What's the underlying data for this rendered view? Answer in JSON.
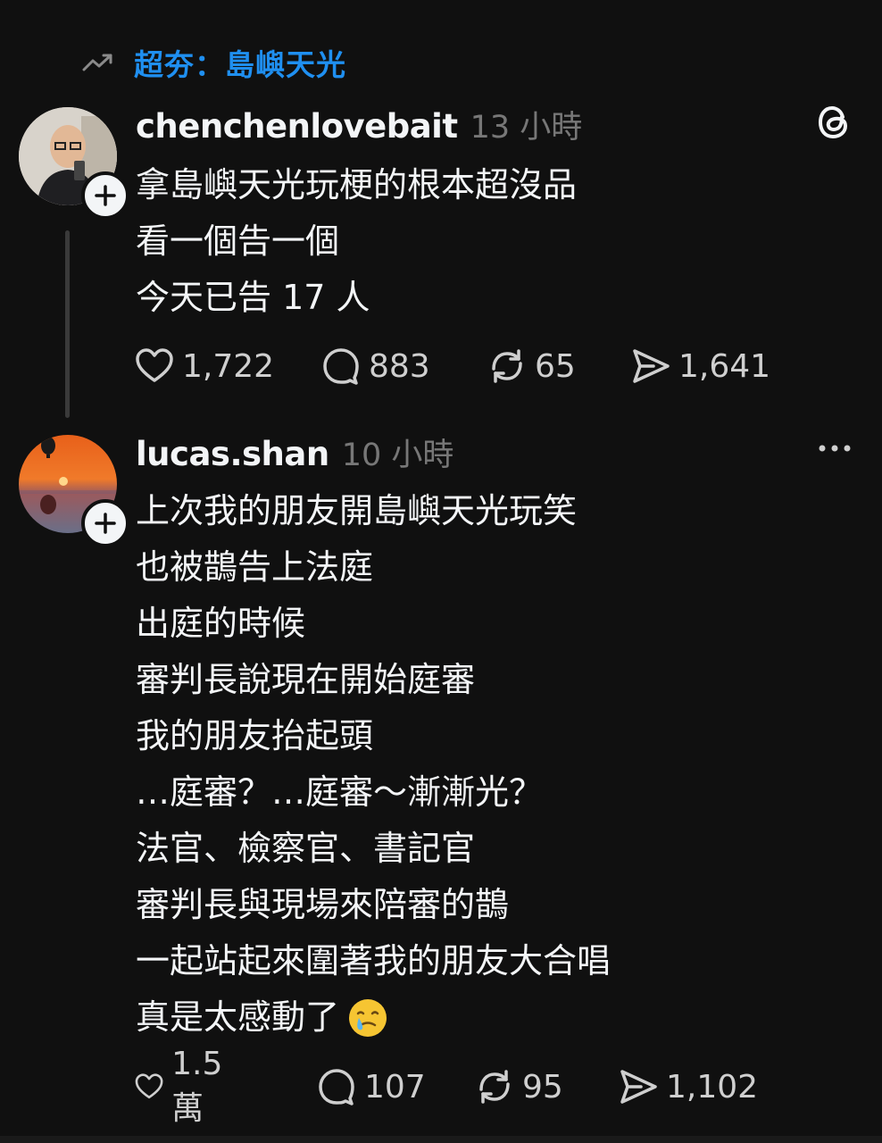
{
  "trending": {
    "icon": "trending-up-icon",
    "label": "超夯：島嶼天光"
  },
  "posts": [
    {
      "username": "chenchenlovebait",
      "time": "13 小時",
      "avatar": "profile-photo-man-with-glasses",
      "corner_icon": "threads-logo-icon",
      "lines": [
        "拿島嶼天光玩梗的根本超沒品",
        "看一個告一個",
        "今天已告 17 人"
      ],
      "likes": "1,722",
      "replies": "883",
      "reposts": "65",
      "shares": "1,641"
    },
    {
      "username": "lucas.shan",
      "time": "10 小時",
      "avatar": "sunset-hot-air-balloons",
      "corner_icon": "more-options-icon",
      "lines": [
        "上次我的朋友開島嶼天光玩笑",
        "也被鵲告上法庭",
        "出庭的時候",
        "審判長說現在開始庭審",
        "我的朋友抬起頭",
        "…庭審？…庭審～漸漸光？",
        "法官、檢察官、書記官",
        "審判長與現場來陪審的鵲",
        "一起站起來圍著我的朋友大合唱",
        "真是太感動了"
      ],
      "emoji": "crying-smile-emoji",
      "likes": "1.5萬",
      "replies": "107",
      "reposts": "95",
      "shares": "1,102"
    }
  ],
  "colors": {
    "background": "#101010",
    "accent": "#1f8ff0",
    "text": "#f3f5f7",
    "muted": "#777777"
  }
}
